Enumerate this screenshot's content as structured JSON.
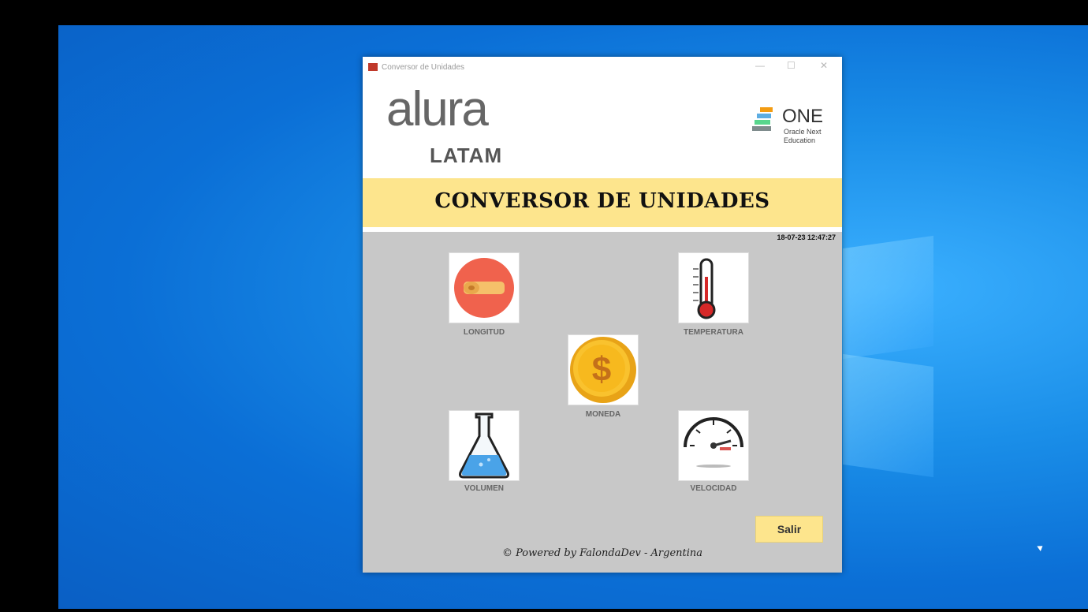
{
  "window": {
    "title": "Conversor de Unidades",
    "controls": {
      "minimize": "—",
      "maximize": "☐",
      "close": "✕"
    }
  },
  "header": {
    "alura": "alura",
    "latam": "LATAM",
    "one_title": "ONE",
    "one_subtitle": "Oracle Next Education"
  },
  "banner": {
    "title": "CONVERSOR DE UNIDADES"
  },
  "clock": "18-07-23 12:47:27",
  "converters": [
    {
      "label": "LONGITUD",
      "icon": "tape-measure-icon"
    },
    {
      "label": "TEMPERATURA",
      "icon": "thermometer-icon"
    },
    {
      "label": "MONEDA",
      "icon": "coin-dollar-icon"
    },
    {
      "label": "VOLUMEN",
      "icon": "flask-icon"
    },
    {
      "label": "VELOCIDAD",
      "icon": "speedometer-icon"
    }
  ],
  "exit_button": "Salir",
  "footer": "© Powered by FalondaDev - Argentina",
  "colors": {
    "banner": "#fde58d",
    "panel": "#c8c8c8",
    "accent": "#f0624d"
  }
}
